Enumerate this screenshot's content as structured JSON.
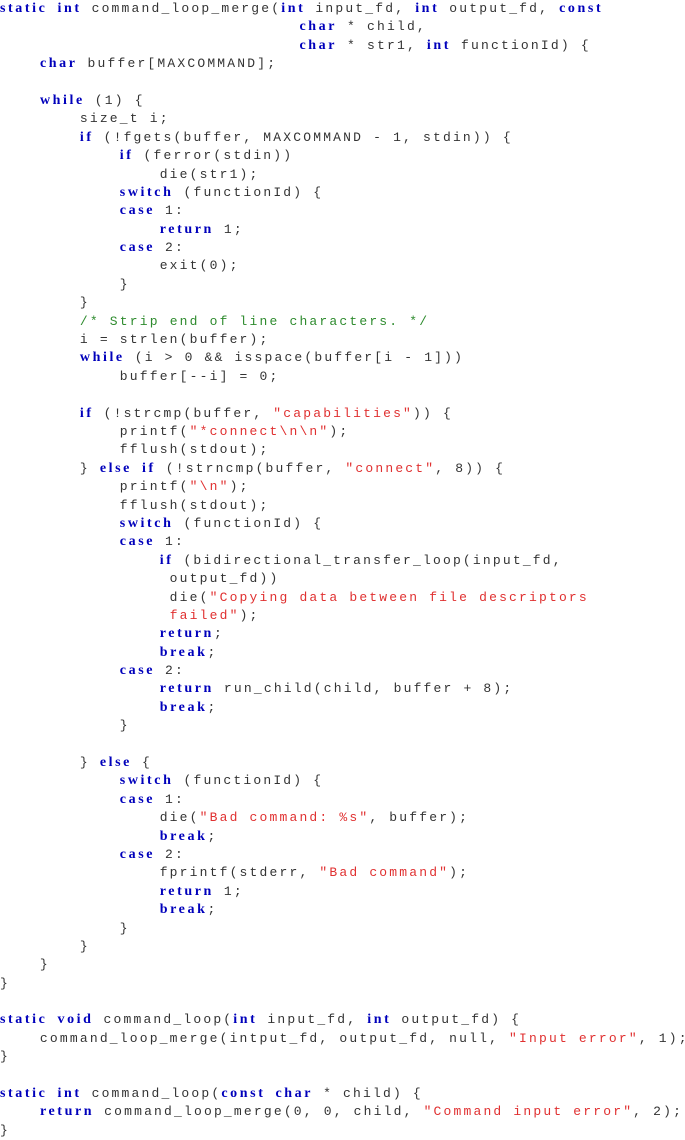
{
  "document": {
    "language": "c",
    "lines": [
      [
        [
          "kw",
          "static"
        ],
        [
          "pl",
          " "
        ],
        [
          "kw",
          "int"
        ],
        [
          "pl",
          " command_loop_merge("
        ],
        [
          "kw",
          "int"
        ],
        [
          "pl",
          " input_fd, "
        ],
        [
          "kw",
          "int"
        ],
        [
          "pl",
          " output_fd, "
        ],
        [
          "kw",
          "const"
        ]
      ],
      [
        [
          "pl",
          "                              "
        ],
        [
          "kw",
          "char"
        ],
        [
          "pl",
          " * child,"
        ]
      ],
      [
        [
          "pl",
          "                              "
        ],
        [
          "kw",
          "char"
        ],
        [
          "pl",
          " * str1, "
        ],
        [
          "kw",
          "int"
        ],
        [
          "pl",
          " functionId) {"
        ]
      ],
      [
        [
          "pl",
          "    "
        ],
        [
          "kw",
          "char"
        ],
        [
          "pl",
          " buffer[MAXCOMMAND];"
        ]
      ],
      [],
      [
        [
          "pl",
          "    "
        ],
        [
          "kw",
          "while"
        ],
        [
          "pl",
          " (1) {"
        ]
      ],
      [
        [
          "pl",
          "        size_t i;"
        ]
      ],
      [
        [
          "pl",
          "        "
        ],
        [
          "kw",
          "if"
        ],
        [
          "pl",
          " (!fgets(buffer, MAXCOMMAND - 1, stdin)) {"
        ]
      ],
      [
        [
          "pl",
          "            "
        ],
        [
          "kw",
          "if"
        ],
        [
          "pl",
          " (ferror(stdin))"
        ]
      ],
      [
        [
          "pl",
          "                die(str1);"
        ]
      ],
      [
        [
          "pl",
          "            "
        ],
        [
          "kw",
          "switch"
        ],
        [
          "pl",
          " (functionId) {"
        ]
      ],
      [
        [
          "pl",
          "            "
        ],
        [
          "kw",
          "case"
        ],
        [
          "pl",
          " 1:"
        ]
      ],
      [
        [
          "pl",
          "                "
        ],
        [
          "kw",
          "return"
        ],
        [
          "pl",
          " 1;"
        ]
      ],
      [
        [
          "pl",
          "            "
        ],
        [
          "kw",
          "case"
        ],
        [
          "pl",
          " 2:"
        ]
      ],
      [
        [
          "pl",
          "                exit(0);"
        ]
      ],
      [
        [
          "pl",
          "            }"
        ]
      ],
      [
        [
          "pl",
          "        }"
        ]
      ],
      [
        [
          "pl",
          "        "
        ],
        [
          "com",
          "/* Strip end of line characters. */"
        ]
      ],
      [
        [
          "pl",
          "        i = strlen(buffer);"
        ]
      ],
      [
        [
          "pl",
          "        "
        ],
        [
          "kw",
          "while"
        ],
        [
          "pl",
          " (i > 0 && isspace(buffer[i - 1]))"
        ]
      ],
      [
        [
          "pl",
          "            buffer[--i] = 0;"
        ]
      ],
      [],
      [
        [
          "pl",
          "        "
        ],
        [
          "kw",
          "if"
        ],
        [
          "pl",
          " (!strcmp(buffer, "
        ],
        [
          "str",
          "\"capabilities\""
        ],
        [
          "pl",
          ")) {"
        ]
      ],
      [
        [
          "pl",
          "            printf("
        ],
        [
          "str",
          "\"*connect\\n\\n\""
        ],
        [
          "pl",
          ");"
        ]
      ],
      [
        [
          "pl",
          "            fflush(stdout);"
        ]
      ],
      [
        [
          "pl",
          "        } "
        ],
        [
          "kw",
          "else"
        ],
        [
          "pl",
          " "
        ],
        [
          "kw",
          "if"
        ],
        [
          "pl",
          " (!strncmp(buffer, "
        ],
        [
          "str",
          "\"connect\""
        ],
        [
          "pl",
          ", 8)) {"
        ]
      ],
      [
        [
          "pl",
          "            printf("
        ],
        [
          "str",
          "\"\\n\""
        ],
        [
          "pl",
          ");"
        ]
      ],
      [
        [
          "pl",
          "            fflush(stdout);"
        ]
      ],
      [
        [
          "pl",
          "            "
        ],
        [
          "kw",
          "switch"
        ],
        [
          "pl",
          " (functionId) {"
        ]
      ],
      [
        [
          "pl",
          "            "
        ],
        [
          "kw",
          "case"
        ],
        [
          "pl",
          " 1:"
        ]
      ],
      [
        [
          "pl",
          "                "
        ],
        [
          "kw",
          "if"
        ],
        [
          "pl",
          " (bidirectional_transfer_loop(input_fd,"
        ]
      ],
      [
        [
          "pl",
          "                 output_fd))"
        ]
      ],
      [
        [
          "pl",
          "                 die("
        ],
        [
          "str",
          "\"Copying data between file descriptors"
        ]
      ],
      [
        [
          "pl",
          "                 "
        ],
        [
          "str",
          "failed\""
        ],
        [
          "pl",
          ");"
        ]
      ],
      [
        [
          "pl",
          "                "
        ],
        [
          "kw",
          "return"
        ],
        [
          "pl",
          ";"
        ]
      ],
      [
        [
          "pl",
          "                "
        ],
        [
          "kw",
          "break"
        ],
        [
          "pl",
          ";"
        ]
      ],
      [
        [
          "pl",
          "            "
        ],
        [
          "kw",
          "case"
        ],
        [
          "pl",
          " 2:"
        ]
      ],
      [
        [
          "pl",
          "                "
        ],
        [
          "kw",
          "return"
        ],
        [
          "pl",
          " run_child(child, buffer + 8);"
        ]
      ],
      [
        [
          "pl",
          "                "
        ],
        [
          "kw",
          "break"
        ],
        [
          "pl",
          ";"
        ]
      ],
      [
        [
          "pl",
          "            }"
        ]
      ],
      [],
      [
        [
          "pl",
          "        } "
        ],
        [
          "kw",
          "else"
        ],
        [
          "pl",
          " {"
        ]
      ],
      [
        [
          "pl",
          "            "
        ],
        [
          "kw",
          "switch"
        ],
        [
          "pl",
          " (functionId) {"
        ]
      ],
      [
        [
          "pl",
          "            "
        ],
        [
          "kw",
          "case"
        ],
        [
          "pl",
          " 1:"
        ]
      ],
      [
        [
          "pl",
          "                die("
        ],
        [
          "str",
          "\"Bad command: %s\""
        ],
        [
          "pl",
          ", buffer);"
        ]
      ],
      [
        [
          "pl",
          "                "
        ],
        [
          "kw",
          "break"
        ],
        [
          "pl",
          ";"
        ]
      ],
      [
        [
          "pl",
          "            "
        ],
        [
          "kw",
          "case"
        ],
        [
          "pl",
          " 2:"
        ]
      ],
      [
        [
          "pl",
          "                fprintf(stderr, "
        ],
        [
          "str",
          "\"Bad command\""
        ],
        [
          "pl",
          ");"
        ]
      ],
      [
        [
          "pl",
          "                "
        ],
        [
          "kw",
          "return"
        ],
        [
          "pl",
          " 1;"
        ]
      ],
      [
        [
          "pl",
          "                "
        ],
        [
          "kw",
          "break"
        ],
        [
          "pl",
          ";"
        ]
      ],
      [
        [
          "pl",
          "            }"
        ]
      ],
      [
        [
          "pl",
          "        }"
        ]
      ],
      [
        [
          "pl",
          "    }"
        ]
      ],
      [
        [
          "pl",
          "}"
        ]
      ],
      [],
      [
        [
          "kw",
          "static"
        ],
        [
          "pl",
          " "
        ],
        [
          "kw",
          "void"
        ],
        [
          "pl",
          " command_loop("
        ],
        [
          "kw",
          "int"
        ],
        [
          "pl",
          " input_fd, "
        ],
        [
          "kw",
          "int"
        ],
        [
          "pl",
          " output_fd) {"
        ]
      ],
      [
        [
          "pl",
          "    command_loop_merge(intput_fd, output_fd, null, "
        ],
        [
          "str",
          "\"Input error\""
        ],
        [
          "pl",
          ", 1);"
        ]
      ],
      [
        [
          "pl",
          "}"
        ]
      ],
      [],
      [
        [
          "kw",
          "static"
        ],
        [
          "pl",
          " "
        ],
        [
          "kw",
          "int"
        ],
        [
          "pl",
          " command_loop("
        ],
        [
          "kw",
          "const"
        ],
        [
          "pl",
          " "
        ],
        [
          "kw",
          "char"
        ],
        [
          "pl",
          " * child) {"
        ]
      ],
      [
        [
          "pl",
          "    "
        ],
        [
          "kw",
          "return"
        ],
        [
          "pl",
          " command_loop_merge(0, 0, child, "
        ],
        [
          "str",
          "\"Command input error\""
        ],
        [
          "pl",
          ", 2);"
        ]
      ],
      [
        [
          "pl",
          "}"
        ]
      ]
    ]
  },
  "colors": {
    "keyword": "#0000bb",
    "string": "#e03030",
    "comment": "#2e8b2e",
    "plain": "#333333",
    "background": "#ffffff"
  }
}
